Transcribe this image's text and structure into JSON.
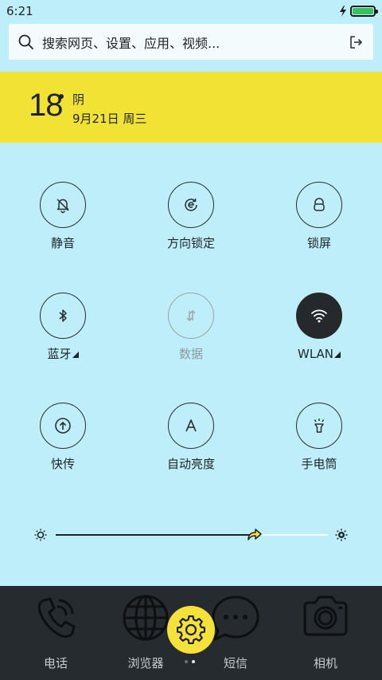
{
  "status_bar": {
    "time": "6:21",
    "battery_level": 1.0
  },
  "search": {
    "placeholder": "搜索网页、设置、应用、视频..."
  },
  "weather": {
    "temperature": "18",
    "condition": "阴",
    "date": "9月21日 周三"
  },
  "toggles": [
    {
      "label": "静音",
      "icon": "bell-off-icon",
      "state": "off"
    },
    {
      "label": "方向锁定",
      "icon": "rotation-lock-icon",
      "state": "off"
    },
    {
      "label": "锁屏",
      "icon": "lock-icon",
      "state": "off"
    },
    {
      "label": "蓝牙",
      "icon": "bluetooth-icon",
      "state": "off",
      "expandable": true
    },
    {
      "label": "数据",
      "icon": "mobile-data-icon",
      "state": "disabled"
    },
    {
      "label": "WLAN",
      "icon": "wifi-icon",
      "state": "on",
      "expandable": true
    },
    {
      "label": "快传",
      "icon": "quick-transfer-icon",
      "state": "off"
    },
    {
      "label": "自动亮度",
      "icon": "auto-brightness-icon",
      "state": "off"
    },
    {
      "label": "手电筒",
      "icon": "flashlight-icon",
      "state": "off"
    }
  ],
  "brightness": {
    "level": 0.73
  },
  "dock": {
    "items": [
      {
        "label": "电话",
        "icon": "phone-icon"
      },
      {
        "label": "浏览器",
        "icon": "globe-icon"
      },
      {
        "label": "短信",
        "icon": "message-icon"
      },
      {
        "label": "相机",
        "icon": "camera-icon"
      }
    ],
    "center_icon": "settings-gear-icon",
    "page_count": 2,
    "active_page": 1
  },
  "colors": {
    "background": "#bdeefa",
    "weather_card": "#f2e234",
    "dock": "#252b2e",
    "accent_yellow": "#f4e13a",
    "battery_green": "#36c25a"
  }
}
